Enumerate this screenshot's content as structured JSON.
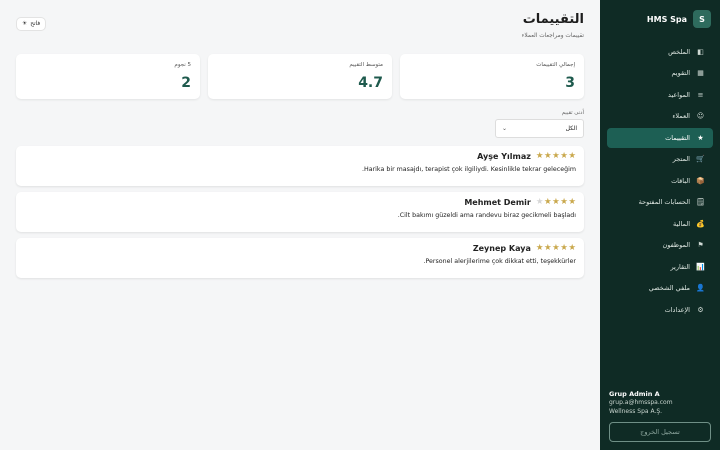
{
  "brand": {
    "logo_letter": "S",
    "name": "HMS Spa"
  },
  "nav": [
    {
      "label": "الملخص",
      "icon": "◧"
    },
    {
      "label": "التقويم",
      "icon": "▦"
    },
    {
      "label": "المواعيد",
      "icon": "≡"
    },
    {
      "label": "العملاء",
      "icon": "☺"
    },
    {
      "label": "التقييمات",
      "icon": "★"
    },
    {
      "label": "المتجر",
      "icon": "🛒"
    },
    {
      "label": "الباقات",
      "icon": "📦"
    },
    {
      "label": "الحسابات المفتوحة",
      "icon": "🗒"
    },
    {
      "label": "المالية",
      "icon": "💰"
    },
    {
      "label": "الموظفون",
      "icon": "⚑"
    },
    {
      "label": "التقارير",
      "icon": "📊"
    },
    {
      "label": "ملفي الشخصي",
      "icon": "👤"
    },
    {
      "label": "الإعدادات",
      "icon": "⚙"
    }
  ],
  "user": {
    "name": "Grup Admin A",
    "email": "grup.a@hmsspa.com",
    "company": "Wellness Spa A.Ş."
  },
  "logout_label": "تسجيل الخروج",
  "page": {
    "title": "التقييمات",
    "subtitle": "تقييمات ومراجعات العملاء"
  },
  "theme_button": {
    "label": "فاتح",
    "icon": "☀"
  },
  "stats": [
    {
      "label": "إجمالي التقييمات",
      "value": "3"
    },
    {
      "label": "متوسط التقييم",
      "value": "4.7"
    },
    {
      "label": "5 نجوم",
      "value": "2"
    }
  ],
  "filter": {
    "label": "أدنى تقييم",
    "selected": "الكل"
  },
  "reviews": [
    {
      "name": "Ayşe Yılmaz",
      "rating": 5,
      "comment": "Harika bir masajdı, terapist çok ilgiliydi. Kesinlikle tekrar geleceğim."
    },
    {
      "name": "Mehmet Demir",
      "rating": 4,
      "comment": "Cilt bakımı güzeldi ama randevu biraz gecikmeli başladı."
    },
    {
      "name": "Zeynep Kaya",
      "rating": 5,
      "comment": "Personel alerjilerime çok dikkat etti, teşekkürler."
    }
  ],
  "colors": {
    "sidebar_bg": "#0f2b25",
    "accent": "#1e5a4d",
    "active_item": "#1d5f54",
    "star": "#c9a84c"
  }
}
